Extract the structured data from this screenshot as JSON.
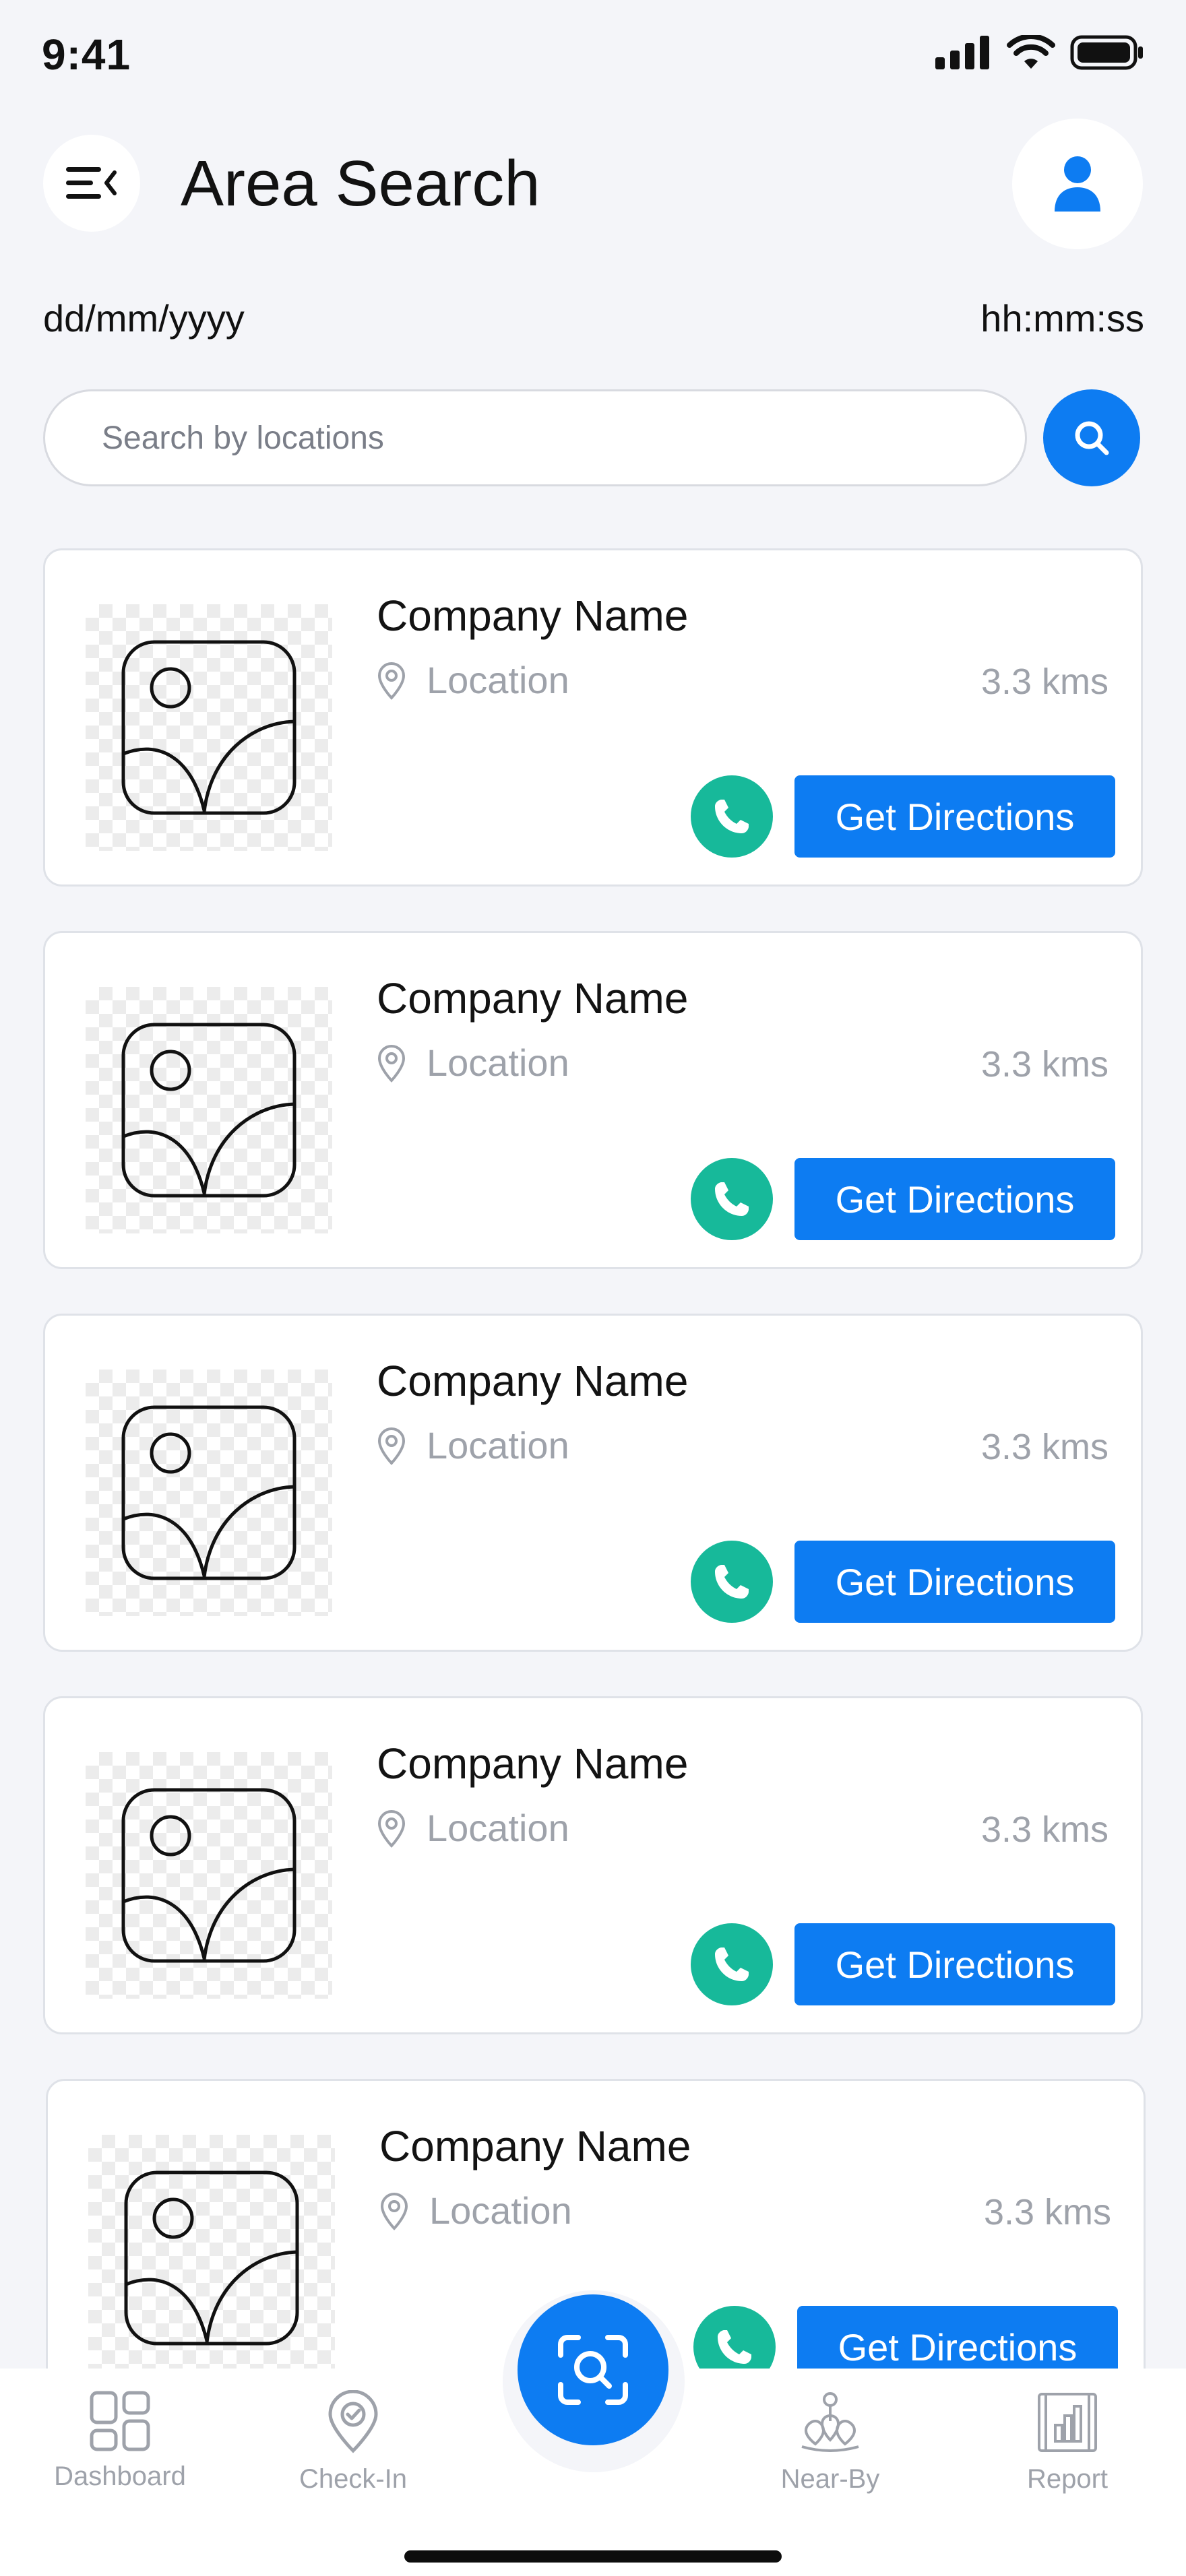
{
  "status_bar": {
    "time": "9:41"
  },
  "header": {
    "title": "Area Search"
  },
  "datetime": {
    "date": "dd/mm/yyyy",
    "time": "hh:mm:ss"
  },
  "search": {
    "placeholder": "Search by locations"
  },
  "cards": [
    {
      "company": "Company Name",
      "location": "Location",
      "distance": "3.3 kms",
      "directions_label": "Get Directions"
    },
    {
      "company": "Company Name",
      "location": "Location",
      "distance": "3.3 kms",
      "directions_label": "Get Directions"
    },
    {
      "company": "Company Name",
      "location": "Location",
      "distance": "3.3 kms",
      "directions_label": "Get Directions"
    },
    {
      "company": "Company Name",
      "location": "Location",
      "distance": "3.3 kms",
      "directions_label": "Get Directions"
    },
    {
      "company": "Company Name",
      "location": "Location",
      "distance": "3.3 kms",
      "directions_label": "Get Directions"
    }
  ],
  "bottom_nav": {
    "items": [
      {
        "label": "Dashboard",
        "icon": "dashboard-icon"
      },
      {
        "label": "Check-In",
        "icon": "check-in-pin-icon"
      },
      {
        "label": "Near-By",
        "icon": "near-by-icon"
      },
      {
        "label": "Report",
        "icon": "report-icon"
      }
    ],
    "center_action_icon": "scan-search-icon"
  },
  "colors": {
    "accent": "#0d7cf2",
    "call": "#17b99a",
    "background": "#f4f5f9",
    "muted_text": "#9ea2aa"
  }
}
